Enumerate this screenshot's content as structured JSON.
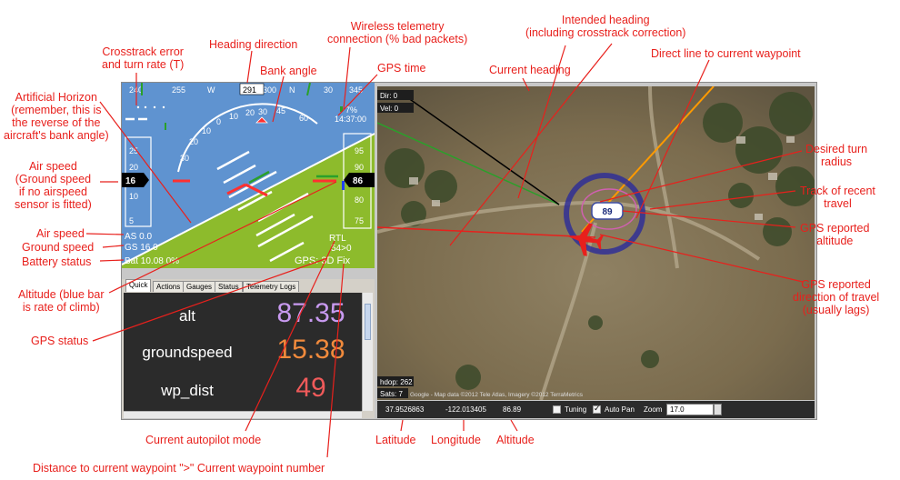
{
  "hud": {
    "heading_ticks": [
      "240",
      "255",
      "W",
      "285",
      "300",
      "N",
      "30",
      "345"
    ],
    "heading_value": "291",
    "pitch_labels": [
      "10",
      "10",
      "-10",
      "-20"
    ],
    "bank_labels": [
      "30",
      "20",
      "10",
      "0",
      "10",
      "20",
      "30",
      "45",
      "60",
      "45",
      "60"
    ],
    "airspeed_value": "16",
    "airspeed_ticks": [
      "25",
      "20",
      "10",
      "5"
    ],
    "altitude_value": "86",
    "altitude_ticks": [
      "95",
      "90",
      "80",
      "75"
    ],
    "telemetry_pct": "7%",
    "gps_time": "14:37:00",
    "air_speed": "AS 0.0",
    "ground_speed": "GS 16.0",
    "battery": "Bat 10.08 0%",
    "mode": "RTL",
    "wp_info": "54>0",
    "gps_status": "GPS: 3D Fix"
  },
  "tabs": [
    "Quick",
    "Actions",
    "Gauges",
    "Status",
    "Telemetry Logs"
  ],
  "quick": [
    {
      "label": "alt",
      "value": "87.35",
      "color": "#c89af0"
    },
    {
      "label": "groundspeed",
      "value": "15.38",
      "color": "#f08a3c"
    },
    {
      "label": "wp_dist",
      "value": "49",
      "color": "#f05a5a"
    }
  ],
  "map": {
    "dir": "Dir: 0",
    "vel": "Vel: 0",
    "hdop": "hdop: 262",
    "sats": "Sats: 7",
    "copyright": "Google - Map data ©2012 Tele Atlas, Imagery ©2012 TerraMetrics",
    "marker_alt": "89"
  },
  "mapbar": {
    "lat": "37.9526863",
    "lng": "-122.013405",
    "alt": "86.89",
    "tuning_label": "Tuning",
    "autopan_label": "Auto Pan",
    "zoom_label": "Zoom",
    "zoom_value": "17.0"
  },
  "annotations": {
    "crosstrack": "Crosstrack error\nand turn rate (T)",
    "heading_direction": "Heading direction",
    "bank_angle": "Bank angle",
    "wireless": "Wireless telemetry\nconnection (% bad packets)",
    "gps_time": "GPS time",
    "artificial_horizon": "Artificial Horizon\n(remember, this is\nthe reverse of the\naircraft's bank angle)",
    "air_speed_ground": "Air speed\n(Ground speed\nif no airspeed\nsensor is fitted)",
    "air_speed": "Air speed",
    "ground_speed": "Ground speed",
    "battery": "Battery status",
    "altitude": "Altitude (blue bar\nis rate of climb)",
    "gps_status": "GPS status",
    "current_mode": "Current autopilot mode",
    "distance": "Distance to current waypoint \">\" Current waypoint number",
    "intended_heading": "Intended heading\n(including crosstrack correction)",
    "current_heading": "Current heading",
    "direct_line": "Direct line to current waypoint",
    "desired_turn": "Desired turn\nradius",
    "track_recent": "Track of recent\ntravel",
    "gps_altitude": "GPS reported\naltitude",
    "gps_direction": "GPS reported\ndirection of travel\n(usually lags)",
    "latitude": "Latitude",
    "longitude": "Longitude",
    "altitude_lbl": "Altitude"
  }
}
